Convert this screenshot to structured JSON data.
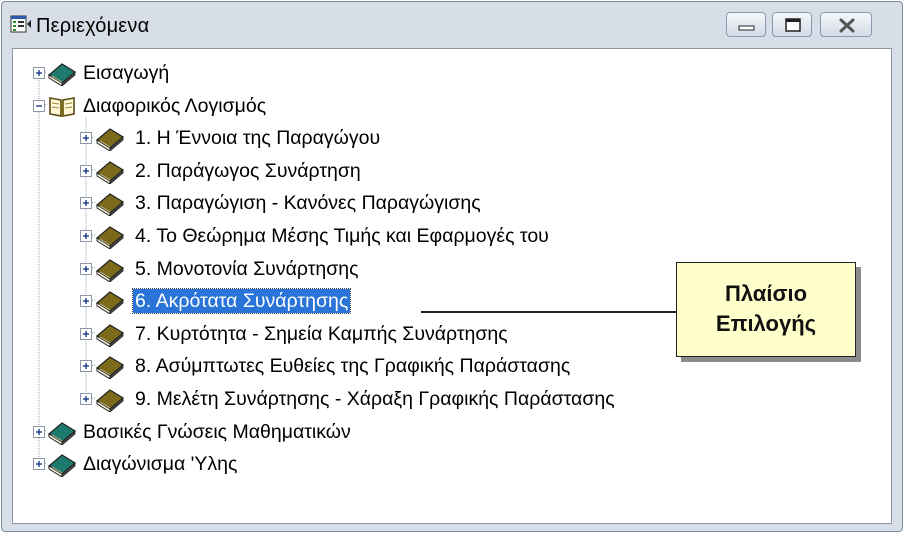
{
  "window": {
    "title": "Περιεχόμενα",
    "controls": {
      "minimize": "minimize-icon",
      "maximize": "maximize-icon",
      "close": "close-icon"
    }
  },
  "tree": {
    "items": [
      {
        "label": "Εισαγωγή",
        "level": 0,
        "state": "collapsed",
        "icon": "book-closed-icon"
      },
      {
        "label": "Διαφορικός Λογισμός",
        "level": 0,
        "state": "expanded",
        "icon": "book-open-icon"
      },
      {
        "label": "1.  Η Έννοια της Παραγώγου",
        "level": 1,
        "state": "collapsed",
        "icon": "book-closed-icon"
      },
      {
        "label": "2.  Παράγωγος Συνάρτηση",
        "level": 1,
        "state": "collapsed",
        "icon": "book-closed-icon"
      },
      {
        "label": "3.  Παραγώγιση - Κανόνες Παραγώγισης",
        "level": 1,
        "state": "collapsed",
        "icon": "book-closed-icon"
      },
      {
        "label": "4.  Το Θεώρημα Μέσης Τιμής και Εφαρμογές του",
        "level": 1,
        "state": "collapsed",
        "icon": "book-closed-icon"
      },
      {
        "label": "5.  Μονοτονία Συνάρτησης",
        "level": 1,
        "state": "collapsed",
        "icon": "book-closed-icon"
      },
      {
        "label": "6.  Ακρότατα Συνάρτησης",
        "level": 1,
        "state": "collapsed",
        "icon": "book-closed-icon",
        "selected": true
      },
      {
        "label": "7.  Κυρτότητα - Σημεία Καμπής Συνάρτησης",
        "level": 1,
        "state": "collapsed",
        "icon": "book-closed-icon"
      },
      {
        "label": "8.  Ασύμπτωτες Ευθείες της Γραφικής Παράστασης",
        "level": 1,
        "state": "collapsed",
        "icon": "book-closed-icon"
      },
      {
        "label": "9.  Μελέτη Συνάρτησης - Χάραξη Γραφικής Παράστασης",
        "level": 1,
        "state": "collapsed",
        "icon": "book-closed-icon"
      },
      {
        "label": "Βασικές Γνώσεις Μαθηματικών",
        "level": 0,
        "state": "collapsed",
        "icon": "book-closed-icon"
      },
      {
        "label": "Διαγώνισμα 'Υλης",
        "level": 0,
        "state": "collapsed",
        "icon": "book-closed-icon"
      }
    ]
  },
  "callout": {
    "line1": "Πλαίσιο",
    "line2": "Επιλογής"
  },
  "colors": {
    "top_level_book": "#1f7a6e",
    "sub_level_book": "#7a6a1a",
    "selection": "#2a74d8",
    "callout_bg": "#ffffcc"
  }
}
